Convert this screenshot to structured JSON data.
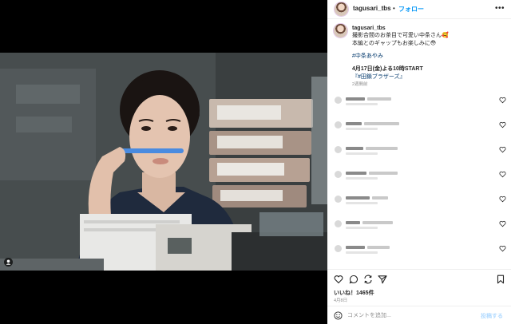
{
  "header": {
    "username": "tagusari_tbs",
    "separator": "•",
    "follow_label": "フォロー",
    "more_icon": "more-horizontal-icon"
  },
  "caption": {
    "username": "tagusari_tbs",
    "lines": [
      "撮影合間のお茶目で可愛い中条さん🥰",
      "本編とのギャップもお楽しみに😳"
    ],
    "hashtag": "#中条あやみ",
    "announce": "4月17日(金)よる10時START",
    "series_tag": "『#田鎖ブラザーズ』",
    "time": "2週間前"
  },
  "comments": {
    "count": 7,
    "note": "blurred comment rows"
  },
  "actions": {
    "icons": [
      "heart-icon",
      "comment-icon",
      "repost-icon",
      "share-icon",
      "bookmark-icon"
    ]
  },
  "likes_text": "いいね！1465件",
  "date_text": "4月8日",
  "comment_box": {
    "placeholder": "コメントを追加...",
    "post_label": "投稿する"
  },
  "colors": {
    "accent": "#0095f6",
    "hashtag": "#00376b",
    "muted": "#8e8e8e",
    "post_disabled": "#b3dbff",
    "media_bg": "#000000"
  }
}
